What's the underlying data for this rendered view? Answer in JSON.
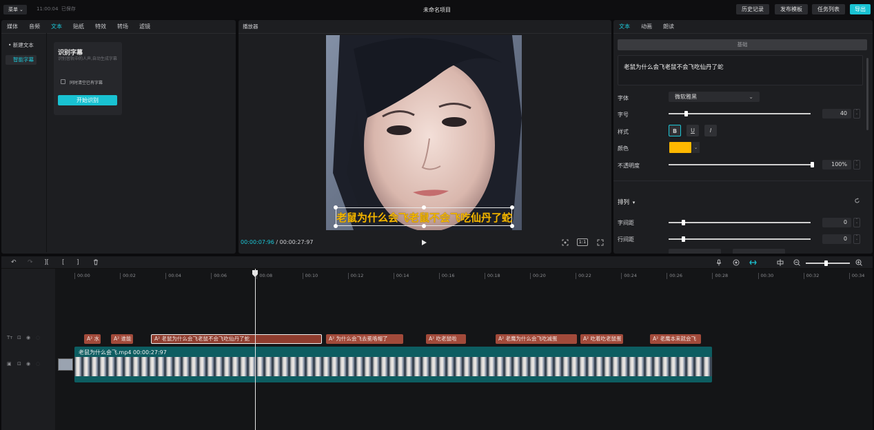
{
  "topbar": {
    "menu_label": "菜单",
    "menu_caret": "⌄",
    "save_time": "11:00:04",
    "save_status": "已保存",
    "project_title": "未命名项目",
    "history_button": "历史记录",
    "publish_button": "发布模板",
    "tasks_button": "任务列表",
    "export_button": "导出"
  },
  "media_panel": {
    "tabs": [
      "媒体",
      "音频",
      "文本",
      "贴纸",
      "特效",
      "转场",
      "滤镜"
    ],
    "active_tab": "文本",
    "side_items": [
      "• 新建文本",
      "智能字幕"
    ],
    "card": {
      "title": "识别字幕",
      "desc": "识别音轨中的人声,自动生成字幕",
      "checkbox_label": "同时清空已有字幕",
      "start_button": "开始识别"
    }
  },
  "player": {
    "header": "播放器",
    "subtitle_text": "老鼠为什么会飞老鼠不会飞吃仙丹了蛇",
    "current_time": "00:00:07:96",
    "separator": "/",
    "total_time": "00:00:27:97",
    "ratio_label": "1:1"
  },
  "properties": {
    "tabs": [
      "文本",
      "动画",
      "朗读"
    ],
    "active_tab": "文本",
    "section_basic": "基础",
    "text_content": "老鼠为什么会飞老鼠不会飞吃仙丹了蛇",
    "font_label": "字体",
    "font_value": "微软雅黑",
    "size_label": "字号",
    "size_value": "40",
    "size_level": 0.12,
    "style_label": "样式",
    "style_buttons": [
      "B",
      "U",
      "I"
    ],
    "color_label": "颜色",
    "color_value": "#ffb800",
    "opacity_label": "不透明度",
    "opacity_value": "100%",
    "opacity_level": 1.0,
    "arrange_label": "排列",
    "arrange_caret": "▾",
    "letter_spacing_label": "字间距",
    "letter_spacing_value": "0",
    "letter_spacing_level": 0.1,
    "line_spacing_label": "行间距",
    "line_spacing_value": "0",
    "line_spacing_level": 0.1
  },
  "timeline": {
    "ruler_ticks": [
      "00:00",
      "00:02",
      "00:04",
      "00:06",
      "00:08",
      "00:10",
      "00:12",
      "00:14",
      "00:16",
      "00:18",
      "00:20",
      "00:22",
      "00:24",
      "00:26",
      "00:28",
      "00:30",
      "00:32",
      "00:34"
    ],
    "text_clips": [
      {
        "label": "A² 水",
        "selected": false
      },
      {
        "label": "A² 谁能",
        "selected": false
      },
      {
        "label": "A² 老鼠为什么会飞老鼠不会飞吃仙丹了蛇",
        "selected": true
      },
      {
        "label": "A² 为什么会飞去冕咯帽了",
        "selected": false
      },
      {
        "label": "A² 吃老鼠啦",
        "selected": false
      },
      {
        "label": "A² 老鹰为什么会飞吃减蛋",
        "selected": false
      },
      {
        "label": "A² 吃着吃老鼠蛋",
        "selected": false
      },
      {
        "label": "A² 老鹰本来就会飞",
        "selected": false
      }
    ],
    "video_clip_label": "老鼠为什么会飞.mp4  00:00:27:97",
    "zoom_level": 0.45
  }
}
